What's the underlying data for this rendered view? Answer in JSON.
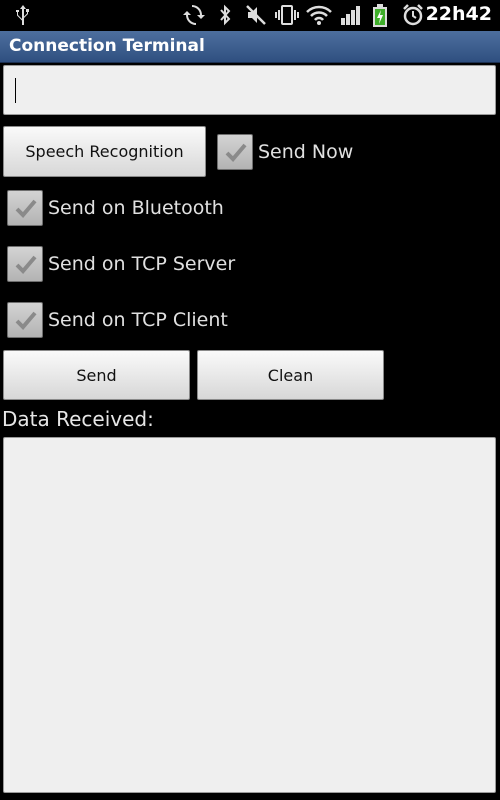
{
  "status_bar": {
    "time": "22h42",
    "icons": [
      "usb-icon",
      "sync-icon",
      "bluetooth-icon",
      "mute-icon",
      "vibrate-icon",
      "wifi-icon",
      "signal-icon",
      "battery-charging-icon",
      "alarm-icon"
    ]
  },
  "app": {
    "title": "Connection Terminal"
  },
  "message_input": {
    "value": "",
    "placeholder": ""
  },
  "buttons": {
    "speech": "Speech Recognition",
    "send": "Send",
    "clean": "Clean"
  },
  "checkboxes": [
    {
      "label": "Send Now",
      "checked": true
    },
    {
      "label": "Send on Bluetooth",
      "checked": true
    },
    {
      "label": "Send on TCP Server",
      "checked": true
    },
    {
      "label": "Send on TCP Client",
      "checked": true
    }
  ],
  "received": {
    "label": "Data Received:",
    "value": ""
  },
  "colors": {
    "title_bar": "#3b5c8c",
    "background": "#000000",
    "input_bg": "#efefef"
  }
}
